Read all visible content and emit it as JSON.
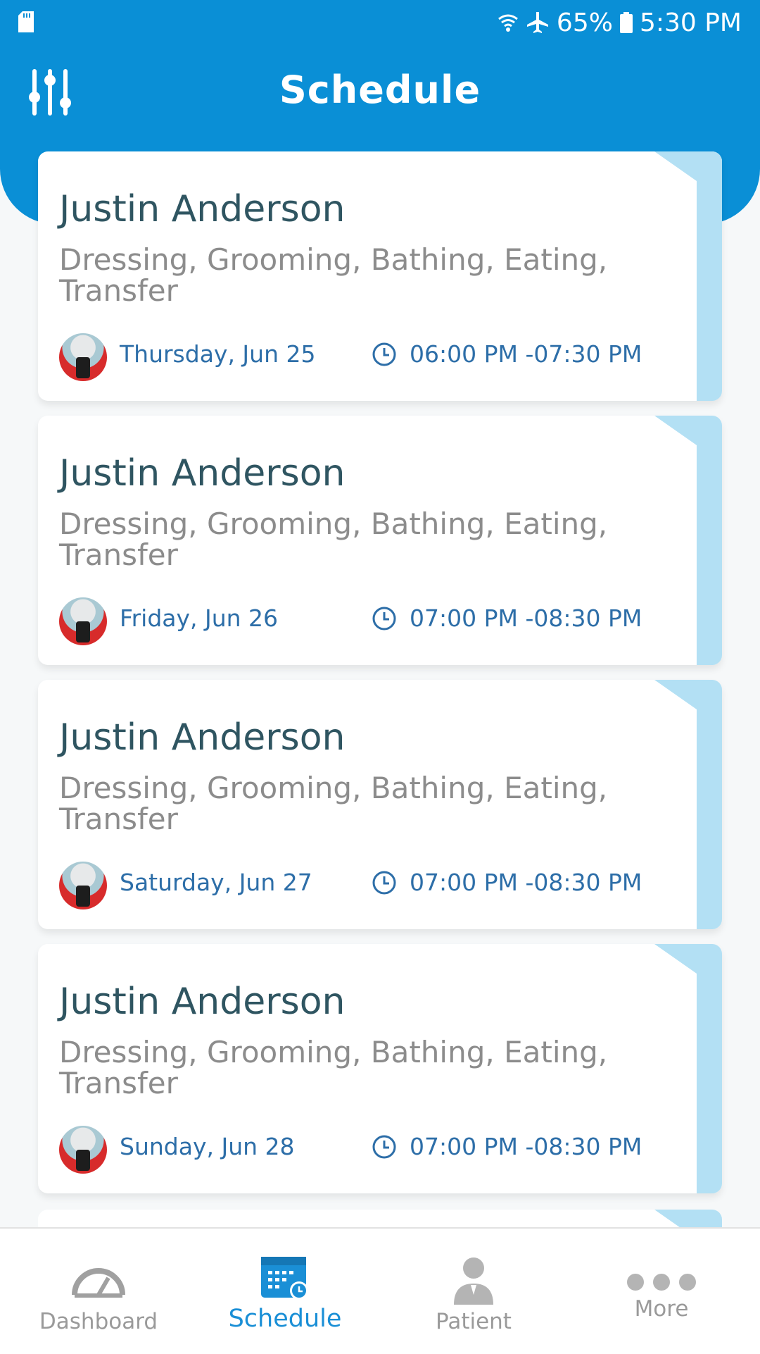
{
  "status_bar": {
    "battery": "65%",
    "time": "5:30 PM",
    "icons": [
      "sd-card-icon",
      "wifi-icon",
      "airplane-mode-icon",
      "battery-icon"
    ]
  },
  "header": {
    "title": "Schedule",
    "left_icon": "sliders-settings-icon"
  },
  "appointments": [
    {
      "name": "Justin Anderson",
      "services": "Dressing, Grooming, Bathing, Eating, Transfer",
      "date": "Thursday, Jun 25",
      "time": "06:00 PM -07:30 PM"
    },
    {
      "name": "Justin Anderson",
      "services": "Dressing, Grooming, Bathing, Eating, Transfer",
      "date": "Friday, Jun 26",
      "time": "07:00 PM -08:30 PM"
    },
    {
      "name": "Justin Anderson",
      "services": "Dressing, Grooming, Bathing, Eating, Transfer",
      "date": "Saturday, Jun 27",
      "time": "07:00 PM -08:30 PM"
    },
    {
      "name": "Justin Anderson",
      "services": "Dressing, Grooming, Bathing, Eating, Transfer",
      "date": "Sunday, Jun 28",
      "time": "07:00 PM -08:30 PM"
    }
  ],
  "tabs": [
    {
      "label": "Dashboard",
      "icon": "speedometer-icon",
      "active": false
    },
    {
      "label": "Schedule",
      "icon": "calendar-icon",
      "active": true
    },
    {
      "label": "Patient",
      "icon": "person-icon",
      "active": false
    },
    {
      "label": "More",
      "icon": "more-dots-icon",
      "active": false
    }
  ],
  "colors": {
    "header": "#0a8fd6",
    "accent": "#1a8fd6",
    "card_edge": "#b3e0f4",
    "name": "#2f5561",
    "services": "#8c8c8c",
    "date_time": "#2d6ea8",
    "tab_inactive": "#9a9a9a"
  }
}
